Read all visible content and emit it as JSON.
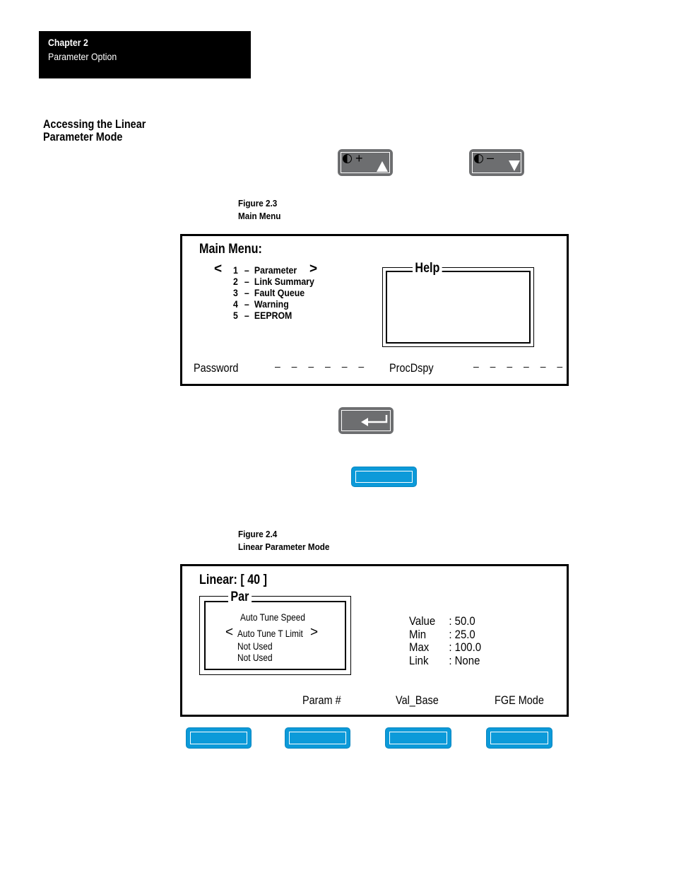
{
  "header": {
    "chapter": "Chapter  2",
    "subtitle": "Parameter Option"
  },
  "section_heading": "Accessing the Linear Parameter Mode",
  "keys": {
    "increment": {
      "icon": "contrast-icon",
      "symbol": "+",
      "arrow": "up-triangle-icon"
    },
    "decrement": {
      "icon": "contrast-icon",
      "symbol": "–",
      "arrow": "down-triangle-icon"
    },
    "enter": {
      "icon": "enter-arrow-icon"
    }
  },
  "figure_2_3": {
    "number": "Figure 2.3",
    "title": "Main Menu",
    "display": {
      "title": "Main Menu:",
      "left_arrow": "<",
      "right_arrow": ">",
      "items": [
        {
          "num": "1",
          "dash": "–",
          "label": "Parameter"
        },
        {
          "num": "2",
          "dash": "–",
          "label": "Link Summary"
        },
        {
          "num": "3",
          "dash": "–",
          "label": "Fault Queue"
        },
        {
          "num": "4",
          "dash": "–",
          "label": "Warning"
        },
        {
          "num": "5",
          "dash": "–",
          "label": "EEPROM"
        }
      ],
      "help_label": "Help",
      "password_label": "Password",
      "password_value": "______",
      "procdspy_label": "ProcDspy",
      "procdspy_value": "______"
    }
  },
  "figure_2_4": {
    "number": "Figure 2.4",
    "title": "Linear Parameter Mode",
    "display": {
      "title": "Linear: [ 40 ]",
      "par_label": "Par",
      "par_items": [
        "Auto Tune Speed",
        "Auto Tune T Limit",
        "Not Used",
        "Not Used"
      ],
      "left_arrow": "<",
      "right_arrow": ">",
      "fields": [
        {
          "key": "Value",
          "value": ": 50.0"
        },
        {
          "key": "Min",
          "value": ": 25.0"
        },
        {
          "key": "Max",
          "value": ": 100.0"
        },
        {
          "key": "Link",
          "value": ": None"
        }
      ],
      "softkey_labels": [
        "",
        "Param #",
        "Val_Base",
        "FGE Mode"
      ]
    }
  },
  "colors": {
    "gray_key": "#6d6e70",
    "blue_key": "#0c9ad9"
  }
}
